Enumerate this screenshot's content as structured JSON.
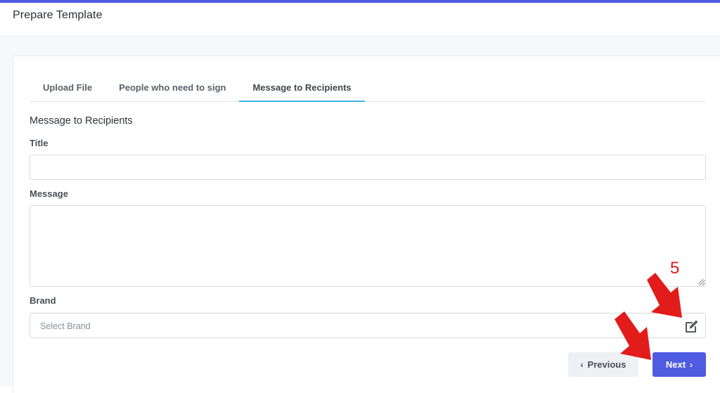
{
  "page": {
    "title": "Prepare Template"
  },
  "tabs": [
    {
      "label": "Upload File",
      "active": false
    },
    {
      "label": "People who need to sign",
      "active": false
    },
    {
      "label": "Message to Recipients",
      "active": true
    }
  ],
  "form": {
    "section_title": "Message to Recipients",
    "title_label": "Title",
    "title_value": "",
    "message_label": "Message",
    "message_value": "",
    "brand_label": "Brand",
    "brand_placeholder": "Select Brand",
    "brand_edit_icon": "edit-icon"
  },
  "actions": {
    "previous_label": "Previous",
    "next_label": "Next"
  },
  "annotation": {
    "step_number": "5"
  },
  "colors": {
    "accent": "#4f5be0",
    "active_tab_underline": "#41b4e6",
    "annotation_red": "#e21b1b"
  }
}
